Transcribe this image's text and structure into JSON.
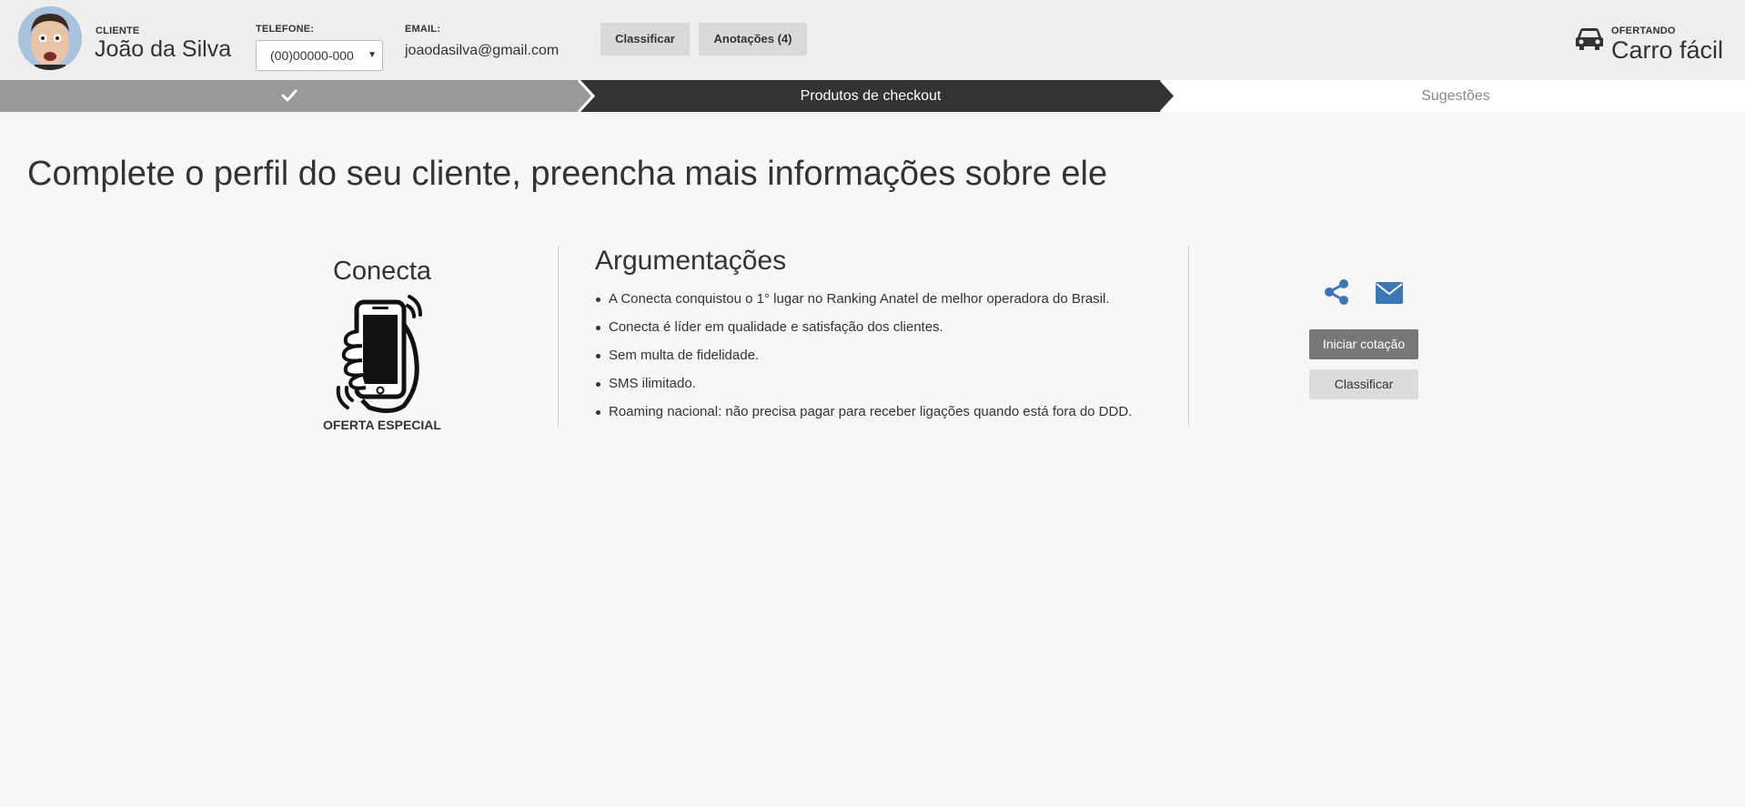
{
  "header": {
    "client_label": "CLIENTE",
    "client_name": "João da Silva",
    "phone_label": "TELEFONE:",
    "phone_value": "(00)00000-000",
    "email_label": "EMAIL:",
    "email_value": "joaodasilva@gmail.com",
    "classify_button": "Classificar",
    "notes_button": "Anotações (4)",
    "offer_label": "OFERTANDO",
    "offer_value": "Carro fácil"
  },
  "stepper": {
    "steps": [
      {
        "label": "",
        "state": "completed",
        "icon": "check-icon"
      },
      {
        "label": "Produtos de checkout",
        "state": "active"
      },
      {
        "label": "Sugestões",
        "state": "pending"
      }
    ]
  },
  "main": {
    "title": "Complete o perfil do seu cliente, preencha mais informações sobre ele",
    "product": {
      "name": "Conecta",
      "icon": "phone-in-hand-icon",
      "tag": "OFERTA ESPECIAL"
    },
    "arguments": {
      "title": "Argumentações",
      "items": [
        "A Conecta conquistou o 1° lugar no Ranking Anatel de melhor operadora do Brasil.",
        "Conecta é líder em qualidade e satisfação dos clientes.",
        "Sem multa de fidelidade.",
        "SMS ilimitado.",
        "Roaming nacional: não precisa pagar para receber ligações quando está fora do DDD."
      ]
    },
    "actions": {
      "share_icon": "share-icon",
      "mail_icon": "envelope-icon",
      "quote_button": "Iniciar cotação",
      "classify_button": "Classificar"
    }
  },
  "colors": {
    "header_bg": "#eeeeee",
    "step_completed": "#999999",
    "step_active": "#333333",
    "step_pending": "#ffffff",
    "icon_blue": "#3a77b4",
    "button_dark": "#777777",
    "button_light": "#dcdcdc"
  }
}
